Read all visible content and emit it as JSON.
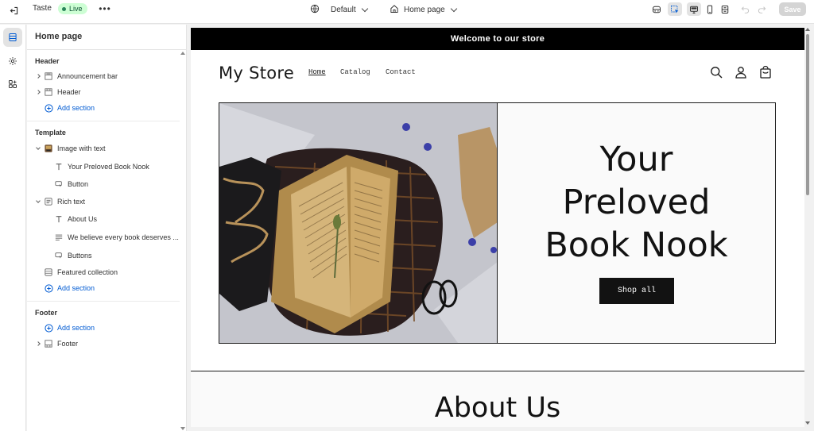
{
  "topbar": {
    "theme_name": "Taste",
    "status": "Live",
    "more": "•••",
    "language_selector": "Default",
    "page_selector": "Home page",
    "save_label": "Save"
  },
  "sidebar": {
    "title": "Home page",
    "groups": {
      "header": {
        "title": "Header",
        "items": [
          "Announcement bar",
          "Header"
        ],
        "add_label": "Add section"
      },
      "template": {
        "title": "Template",
        "image_with_text": "Image with text",
        "image_with_text_blocks": [
          "Your Preloved Book Nook",
          "Button"
        ],
        "rich_text": "Rich text",
        "rich_text_blocks": [
          "About Us",
          "We believe every book deserves ...",
          "Buttons"
        ],
        "featured_collection": "Featured collection",
        "add_label": "Add section"
      },
      "footer": {
        "title": "Footer",
        "add_label": "Add section",
        "items": [
          "Footer"
        ]
      }
    }
  },
  "preview": {
    "announcement": "Welcome to our store",
    "store_name": "My Store",
    "nav": [
      "Home",
      "Catalog",
      "Contact"
    ],
    "hero": {
      "heading_lines": [
        "Your",
        "Preloved",
        "Book Nook"
      ],
      "button": "Shop all"
    },
    "about_heading": "About Us"
  },
  "colors": {
    "accent": "#005bd3",
    "live_badge_bg": "#cdfed4",
    "live_badge_dot": "#29845a",
    "announcement_bg": "#000000",
    "button_bg": "#121212"
  },
  "icons": {
    "topbar": [
      "exit-icon",
      "globe-icon",
      "home-icon",
      "inspector-icon",
      "select-icon",
      "desktop-icon",
      "mobile-icon",
      "fullwidth-icon",
      "undo-icon",
      "redo-icon"
    ],
    "rail": [
      "sections-icon",
      "settings-gear-icon",
      "apps-icon"
    ],
    "store_header": [
      "search-icon",
      "account-icon",
      "cart-icon"
    ]
  }
}
